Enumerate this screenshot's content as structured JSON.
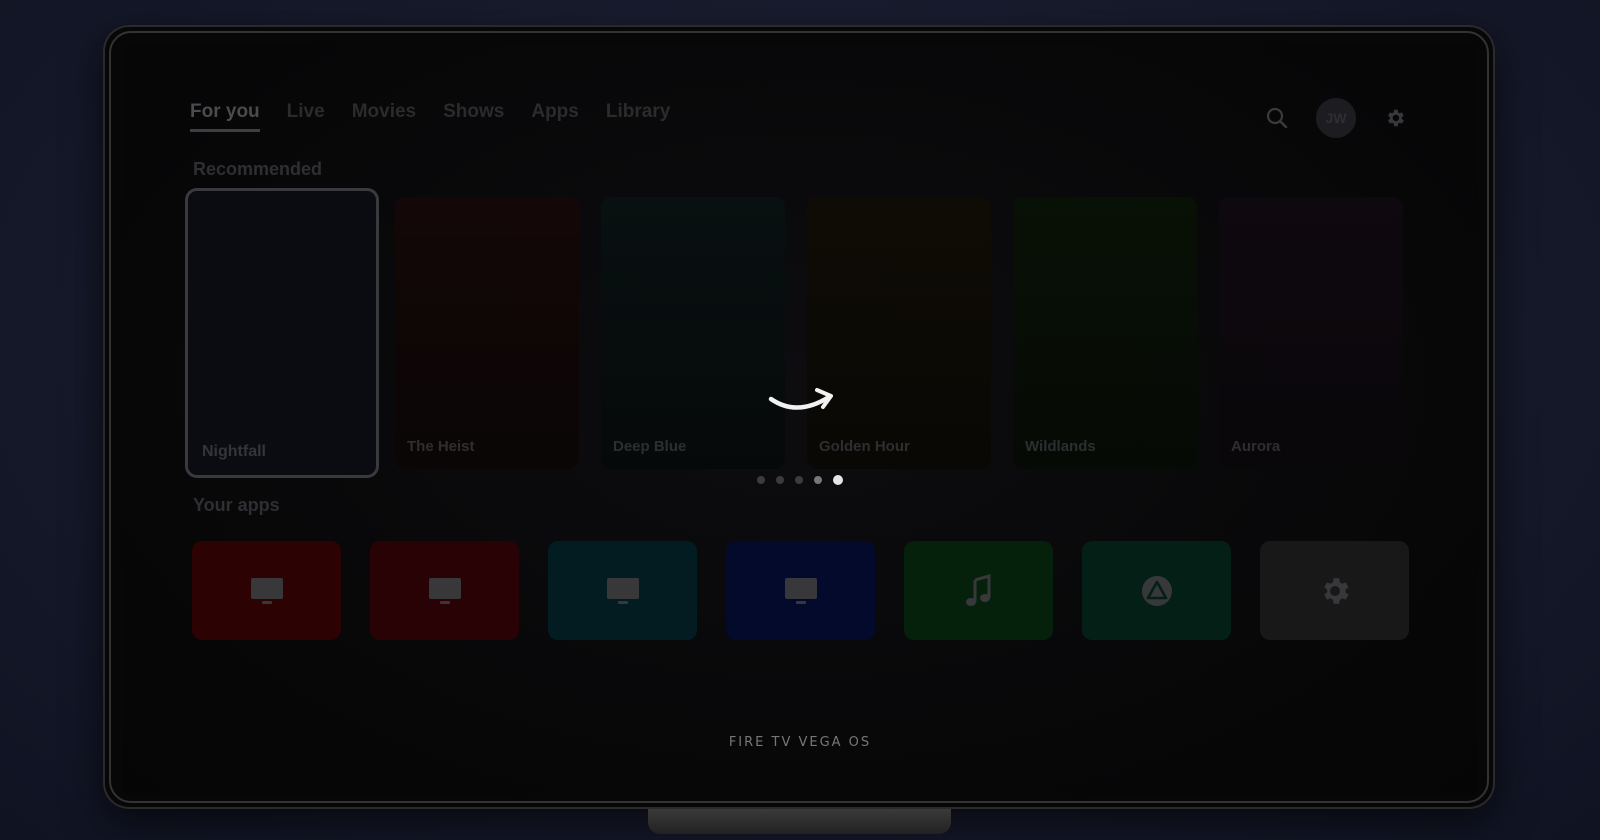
{
  "nav": {
    "tabs": [
      {
        "label": "For you",
        "active": true
      },
      {
        "label": "Live",
        "active": false
      },
      {
        "label": "Movies",
        "active": false
      },
      {
        "label": "Shows",
        "active": false
      },
      {
        "label": "Apps",
        "active": false
      },
      {
        "label": "Library",
        "active": false
      }
    ],
    "search_icon": "search-icon",
    "settings_icon": "gear-icon",
    "avatar_initials": "JW"
  },
  "recommended": {
    "label": "Recommended",
    "cards": [
      {
        "title": "Nightfall",
        "color": "#0b0b12",
        "focused": true
      },
      {
        "title": "The Heist",
        "color": "#130707"
      },
      {
        "title": "Deep Blue",
        "color": "#070f10"
      },
      {
        "title": "Golden Hour",
        "color": "#0e0c05"
      },
      {
        "title": "Wildlands",
        "color": "#071006"
      },
      {
        "title": "Aurora",
        "color": "#0d080e"
      }
    ],
    "pager": {
      "count": 5,
      "active_index": 5
    }
  },
  "apps": {
    "label": "Your apps",
    "tiles": [
      {
        "icon": "tv-icon",
        "color": "#2c0202"
      },
      {
        "icon": "tv-icon",
        "color": "#280205"
      },
      {
        "icon": "tv-icon",
        "color": "#031c22"
      },
      {
        "icon": "tv-icon",
        "color": "#030a2c"
      },
      {
        "icon": "music-note-icon",
        "color": "#05200b"
      },
      {
        "icon": "store-icon",
        "color": "#031f16"
      },
      {
        "icon": "gear-icon",
        "color": "#181818"
      }
    ]
  },
  "footer": {
    "brand": "FIRE TV VEGA OS"
  },
  "loading_icon": "amazon-smile-arrow-icon"
}
